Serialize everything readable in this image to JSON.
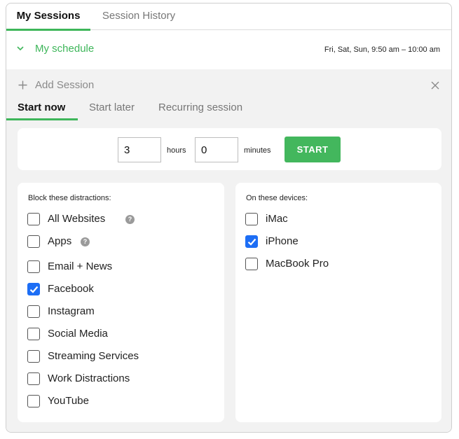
{
  "tabs": {
    "my_sessions": "My Sessions",
    "session_history": "Session History"
  },
  "schedule": {
    "title": "My schedule",
    "time": "Fri, Sat, Sun, 9:50 am – 10:00 am"
  },
  "add_session": {
    "label": "Add Session"
  },
  "sub_tabs": {
    "start_now": "Start now",
    "start_later": "Start later",
    "recurring": "Recurring session"
  },
  "timer": {
    "hours_value": "3",
    "hours_unit": "hours",
    "minutes_value": "0",
    "minutes_unit": "minutes",
    "start_label": "START"
  },
  "distractions": {
    "label": "Block these distractions:",
    "items": [
      {
        "label": "All Websites",
        "checked": false,
        "help": true
      },
      {
        "label": "Apps",
        "checked": false,
        "help": true
      },
      {
        "label": "Email + News",
        "checked": false
      },
      {
        "label": "Facebook",
        "checked": true
      },
      {
        "label": "Instagram",
        "checked": false
      },
      {
        "label": "Social Media",
        "checked": false
      },
      {
        "label": "Streaming Services",
        "checked": false
      },
      {
        "label": "Work Distractions",
        "checked": false
      },
      {
        "label": "YouTube",
        "checked": false
      }
    ]
  },
  "devices": {
    "label": "On these devices:",
    "items": [
      {
        "label": "iMac",
        "checked": false
      },
      {
        "label": "iPhone",
        "checked": true
      },
      {
        "label": "MacBook Pro",
        "checked": false
      }
    ]
  },
  "colors": {
    "accent_green": "#3eb65a",
    "checkbox_blue": "#1d6ef5",
    "panel_gray": "#f2f2f2"
  },
  "icons": {
    "schedule_toggle": "chevron-down-icon",
    "add": "plus-icon",
    "close": "close-icon",
    "help": "help-icon",
    "check": "checkmark-icon"
  }
}
